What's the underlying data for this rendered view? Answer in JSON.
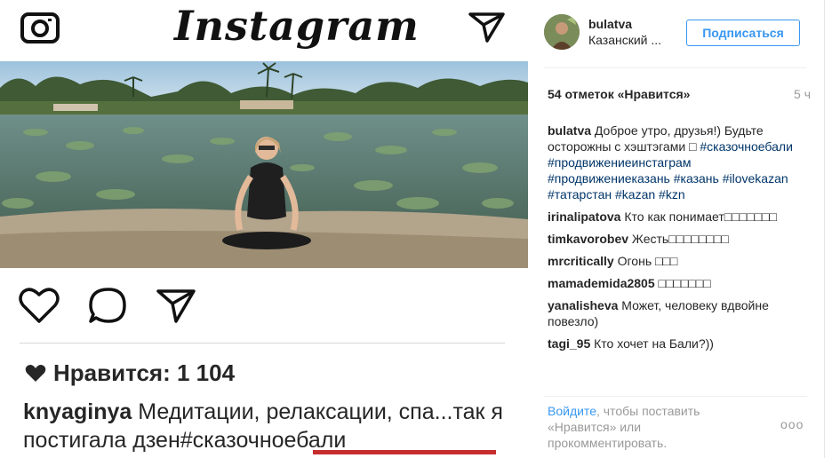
{
  "left_post": {
    "logo_text": "Instagram",
    "likes_text": "Нравится: 1 104",
    "caption_user": "knyaginya",
    "caption_text": " Медитации, релаксации, спа...так я постигала дзен",
    "caption_tag": "#сказочноебали"
  },
  "panel": {
    "username": "bulatva",
    "location": "Казанский ...",
    "follow_label": "Подписаться",
    "likes": "54 отметок «Нравится»",
    "time": "5 ч",
    "comments": [
      {
        "user": "bulatva",
        "text": " Доброе утро, друзья!) Будьте осторожны с хэштэгами □",
        "tags": " #сказочноебали #продвижениеинстаграм #продвижениеказань #казань #ilovekazan #татарстан #kazan #kzn"
      },
      {
        "user": "irinalipatova",
        "text": " Кто как понимает□□□□□□□",
        "tags": ""
      },
      {
        "user": "timkavorobev",
        "text": " Жесть□□□□□□□□",
        "tags": ""
      },
      {
        "user": "mrcritically",
        "text": " Огонь □□□",
        "tags": ""
      },
      {
        "user": "mamademida2805",
        "text": " □□□□□□□",
        "tags": ""
      },
      {
        "user": "yanalisheva",
        "text": " Может, человеку вдвойне повезло)",
        "tags": ""
      },
      {
        "user": "tagi_95",
        "text": " Кто хочет на Бали?))",
        "tags": ""
      }
    ],
    "login_link": "Войдите",
    "login_text": ", чтобы поставить «Нравится» или прокомментировать.",
    "more_label": "ooo"
  },
  "colors": {
    "accent": "#3897f0",
    "hashtag": "#003569",
    "underline": "#c62d2d"
  },
  "icons": [
    "camera-icon",
    "send-icon",
    "heart-icon",
    "comment-icon",
    "share-icon",
    "more-icon"
  ]
}
